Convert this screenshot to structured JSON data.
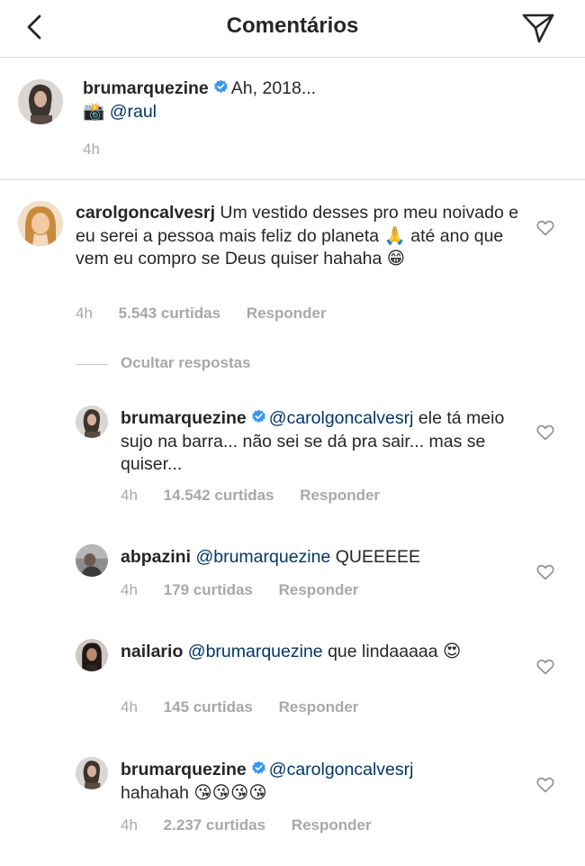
{
  "header": {
    "title": "Comentários"
  },
  "caption": {
    "username": "brumarquezine",
    "text": "Ah, 2018...",
    "camera_emoji": "📸",
    "mention": "@raul",
    "time": "4h"
  },
  "comments": [
    {
      "username": "carolgoncalvesrj",
      "text_1": "Um vestido desses pro meu noivado e eu serei a pessoa mais feliz do planeta",
      "emoji_1": "🙏",
      "text_2": "até ano que vem eu compro se Deus quiser hahaha",
      "emoji_2": "😁",
      "time": "4h",
      "likes": "5.543 curtidas",
      "reply": "Responder"
    }
  ],
  "hide_replies_label": "Ocultar respostas",
  "replies": [
    {
      "username": "brumarquezine",
      "mention": "@carolgoncalvesrj",
      "text": " ele tá meio sujo na barra... não sei se dá pra sair... mas se quiser...",
      "time": "4h",
      "likes": "14.542 curtidas",
      "reply": "Responder"
    },
    {
      "username": "abpazini",
      "mention": "@brumarquezine",
      "text": "QUEEEEE",
      "time": "4h",
      "likes": "179 curtidas",
      "reply": "Responder"
    },
    {
      "username": "nailario",
      "mention": "@brumarquezine",
      "text": "que lindaaaaa",
      "emoji": "😍",
      "time": "4h",
      "likes": "145 curtidas",
      "reply": "Responder"
    },
    {
      "username": "brumarquezine",
      "mention": "@carolgoncalvesrj",
      "text": "hahahah",
      "emoji": "😘😘😘😘",
      "time": "4h",
      "likes": "2.237 curtidas",
      "reply": "Responder"
    }
  ],
  "colors": {
    "text": "#262626",
    "secondary": "#a8a8a8",
    "mention": "#00376b",
    "verified": "#3897f0",
    "divider": "#dbdbdb"
  }
}
